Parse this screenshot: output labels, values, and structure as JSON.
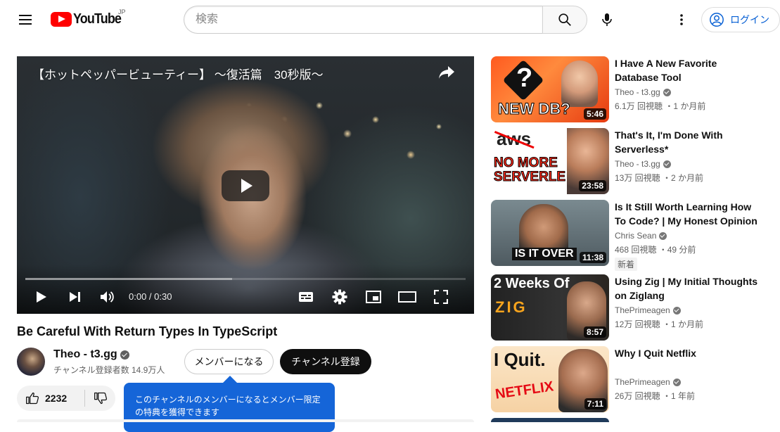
{
  "header": {
    "logo_text": "YouTube",
    "region": "JP",
    "search_placeholder": "検索",
    "login_label": "ログイン"
  },
  "player": {
    "title": "【ホットペッパービューティー】 〜復活篇　30秒版〜",
    "time": "0:00 / 0:30",
    "progress_buffered": 0.47
  },
  "video": {
    "title": "Be Careful With Return Types In TypeScript",
    "channel_name": "Theo - t3.gg",
    "subscribers": "チャンネル登録者数 14.9万人",
    "member_label": "メンバーになる",
    "subscribe_label": "チャンネル登録",
    "like_count": "2232",
    "tooltip": "このチャンネルのメンバーになるとメンバー限定の特典を獲得できます"
  },
  "recommendations": [
    {
      "title": "I Have A New Favorite Database Tool",
      "channel": "Theo - t3.gg",
      "meta": "6.1万 回視聴 ・1 か月前",
      "duration": "5:46",
      "thumb_text": "NEW DB?",
      "badge": ""
    },
    {
      "title": "That's It, I'm Done With Serverless*",
      "channel": "Theo - t3.gg",
      "meta": "13万 回視聴 ・2 か月前",
      "duration": "23:58",
      "thumb_text": "NO MORE SERVERLE",
      "thumb_logo": "aws",
      "badge": ""
    },
    {
      "title": "Is It Still Worth Learning How To Code? | My Honest Opinion |...",
      "channel": "Chris Sean",
      "meta": "468 回視聴 ・49 分前",
      "duration": "11:38",
      "thumb_text": "IS IT OVER",
      "badge": "新着"
    },
    {
      "title": "Using Zig | My Initial Thoughts on Ziglang",
      "channel": "ThePrimeagen",
      "meta": "12万 回視聴 ・1 か月前",
      "duration": "8:57",
      "thumb_text": "2 Weeks Of",
      "thumb_logo": "ZIG",
      "badge": ""
    },
    {
      "title": "Why I Quit Netflix",
      "channel": "ThePrimeagen",
      "meta": "26万 回視聴 ・1 年前",
      "duration": "7:11",
      "thumb_text": "I Quit.",
      "thumb_logo": "NETFLIX",
      "badge": ""
    }
  ]
}
